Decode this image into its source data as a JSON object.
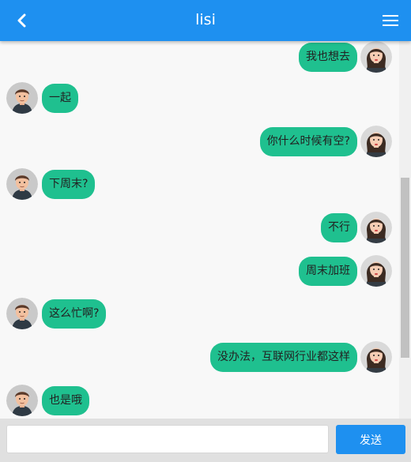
{
  "header": {
    "title": "lisi",
    "back_icon": "chevron-left-icon",
    "menu_icon": "hamburger-menu-icon",
    "bg_color": "#1e90f0"
  },
  "messages": [
    {
      "side": "right",
      "text": "我也想去",
      "avatar": "female-avatar"
    },
    {
      "side": "left",
      "text": "一起",
      "avatar": "male-avatar"
    },
    {
      "side": "right",
      "text": "你什么时候有空?",
      "avatar": "female-avatar"
    },
    {
      "side": "left",
      "text": "下周末?",
      "avatar": "male-avatar"
    },
    {
      "side": "right",
      "text": "不行",
      "avatar": "female-avatar"
    },
    {
      "side": "right",
      "text": "周末加班",
      "avatar": "female-avatar"
    },
    {
      "side": "left",
      "text": "这么忙啊?",
      "avatar": "male-avatar"
    },
    {
      "side": "right",
      "text": "没办法，互联网行业都这样",
      "avatar": "female-avatar"
    },
    {
      "side": "left",
      "text": "也是哦",
      "avatar": "male-avatar"
    }
  ],
  "bubble_color": "#1fc08f",
  "composer": {
    "input_value": "",
    "input_placeholder": "",
    "send_label": "发送"
  }
}
